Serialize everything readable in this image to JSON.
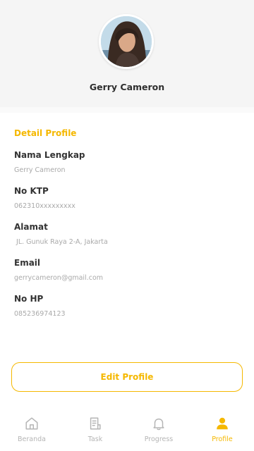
{
  "profile": {
    "name": "Gerry Cameron"
  },
  "detail": {
    "title": "Detail Profile",
    "fields": [
      {
        "label": "Nama Lengkap",
        "value": "Gerry Cameron"
      },
      {
        "label": "No KTP",
        "value": "062310xxxxxxxxx"
      },
      {
        "label": "Alamat",
        "value": " JL. Gunuk Raya 2-A, Jakarta"
      },
      {
        "label": "Email",
        "value": "gerrycameron@gmail.com"
      },
      {
        "label": "No HP",
        "value": "085236974123"
      }
    ]
  },
  "actions": {
    "edit_label": "Edit Profile"
  },
  "nav": {
    "items": [
      {
        "label": "Beranda",
        "icon": "home-icon"
      },
      {
        "label": "Task",
        "icon": "task-icon"
      },
      {
        "label": "Progress",
        "icon": "bell-icon"
      },
      {
        "label": "Profile",
        "icon": "person-icon",
        "active": true
      }
    ]
  },
  "colors": {
    "accent": "#f5b800",
    "inactive": "#b5b5b5",
    "header_bg": "#f5f5f5"
  }
}
